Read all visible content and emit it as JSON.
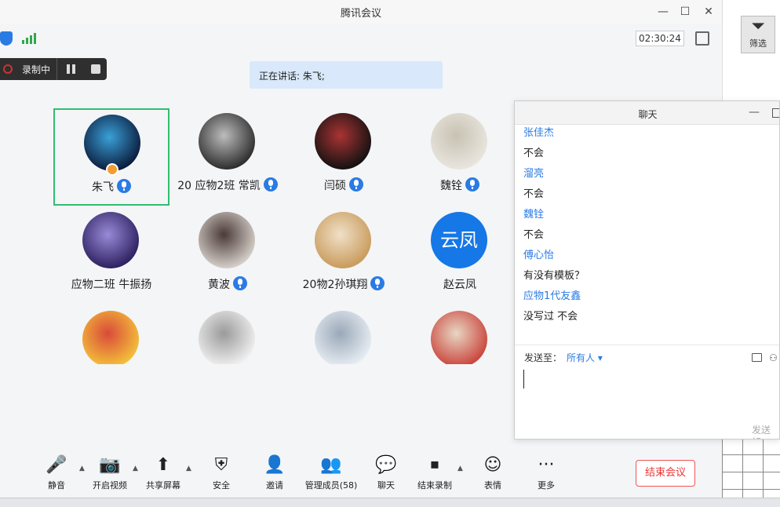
{
  "window": {
    "title": "腾讯会议",
    "timer": "02:30:24"
  },
  "background_app": {
    "filter_label": "筛选"
  },
  "recording": {
    "label": "录制中"
  },
  "speaking": {
    "text": "正在讲话: 朱飞;"
  },
  "participants": [
    {
      "name": "朱飞",
      "mic": true,
      "active": true,
      "colors": [
        "#0a1a3a",
        "#3aa0d8"
      ]
    },
    {
      "name": "20 应物2班 常凯",
      "mic": true,
      "colors": [
        "#2b2b2b",
        "#bdbdbd"
      ]
    },
    {
      "name": "闫硕",
      "mic": true,
      "colors": [
        "#111",
        "#a33"
      ]
    },
    {
      "name": "魏铨",
      "mic": true,
      "colors": [
        "#e9e6df",
        "#c9c2b3"
      ]
    },
    {
      "name": "应物二班 牛振扬",
      "mic": false,
      "colors": [
        "#2b1f5e",
        "#9a8ad8"
      ]
    },
    {
      "name": "黄波",
      "mic": true,
      "colors": [
        "#d8d2cc",
        "#4a3a38"
      ]
    },
    {
      "name": "20物2孙琪翔",
      "mic": true,
      "colors": [
        "#c89a5a",
        "#f0e0c8"
      ]
    },
    {
      "name": "赵云凤",
      "mic": false,
      "colors": [
        "#1677e6",
        "#1677e6"
      ],
      "text_avatar": "云凤"
    },
    {
      "name": "",
      "mic": false,
      "colors": [
        "#f4c23a",
        "#d94a3a"
      ]
    },
    {
      "name": "",
      "mic": false,
      "colors": [
        "#f2f2f2",
        "#9a9a9a"
      ]
    },
    {
      "name": "",
      "mic": false,
      "colors": [
        "#e8eef4",
        "#9aa8b8"
      ]
    },
    {
      "name": "",
      "mic": false,
      "colors": [
        "#c9433a",
        "#e8d7c4"
      ]
    }
  ],
  "chat": {
    "title": "聊天",
    "messages": [
      {
        "sender": "张佳杰",
        "text": "不会"
      },
      {
        "sender": "溜亮",
        "text": "不会"
      },
      {
        "sender": "魏铨",
        "text": "不会"
      },
      {
        "sender": "傅心怡",
        "text": "有没有模板？"
      },
      {
        "sender": "应物1代友鑫",
        "text": "没写过  不会"
      }
    ],
    "send_to_label": "发送至：",
    "send_to_target": "所有人 ▾",
    "send_button": "发送(S"
  },
  "toolbar": {
    "items": [
      {
        "label": "静音",
        "icon": "🎤"
      },
      {
        "label": "开启视频",
        "icon": "📷"
      },
      {
        "label": "共享屏幕",
        "icon": "⬆"
      },
      {
        "label": "安全",
        "icon": "⛨"
      },
      {
        "label": "邀请",
        "icon": "👤"
      },
      {
        "label": "管理成员(58)",
        "icon": "👥"
      },
      {
        "label": "聊天",
        "icon": "💬"
      },
      {
        "label": "结束录制",
        "icon": "⏹"
      },
      {
        "label": "表情",
        "icon": "☺"
      },
      {
        "label": "更多",
        "icon": "···"
      }
    ],
    "end_label": "结束会议"
  },
  "colors": {
    "accent": "#2a7be4",
    "active_border": "#2fbf71",
    "end": "#e33333"
  }
}
